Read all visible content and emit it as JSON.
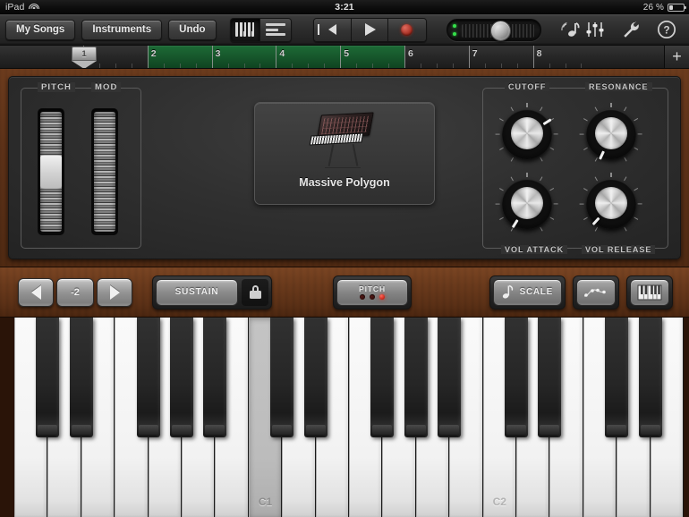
{
  "status_bar": {
    "device": "iPad",
    "wifi_icon": "wifi-icon",
    "time": "3:21",
    "battery_percent": "26 %",
    "battery_icon": "battery-icon"
  },
  "toolbar": {
    "my_songs": "My Songs",
    "instruments": "Instruments",
    "undo": "Undo",
    "view_keyboard_icon": "keyboard-icon",
    "view_tracks_icon": "tracks-list-icon",
    "rewind_icon": "rewind-icon",
    "play_icon": "play-icon",
    "record_icon": "record-icon",
    "master_volume_icon": "master-volume-slider",
    "metronome_icon": "metronome-note-icon",
    "mixer_icon": "mixer-faders-icon",
    "settings_icon": "wrench-icon",
    "help_icon": "help-question-icon"
  },
  "ruler": {
    "playhead_label": "1",
    "bars": [
      "1",
      "2",
      "3",
      "4",
      "5",
      "6",
      "7",
      "8"
    ],
    "loop_start_bar": "2",
    "loop_end_bar": "6",
    "add_section_label": "+",
    "loop_color": "#17582c"
  },
  "synth": {
    "pitch_label": "PITCH",
    "mod_label": "MOD",
    "instrument_name": "Massive Polygon",
    "instrument_art_icon": "synth-rack-icon",
    "knobs": [
      {
        "label": "CUTOFF",
        "angle": 58
      },
      {
        "label": "RESONANCE",
        "angle": 205
      },
      {
        "label": "VOL ATTACK",
        "angle": 212
      },
      {
        "label": "VOL RELEASE",
        "angle": 222
      }
    ]
  },
  "control_strip": {
    "octave_down_icon": "arrow-left-icon",
    "octave_value": "-2",
    "octave_up_icon": "arrow-right-icon",
    "sustain_label": "SUSTAIN",
    "lock_icon": "lock-icon",
    "pitch_label": "PITCH",
    "pitch_leds": [
      "off",
      "off",
      "on"
    ],
    "scale_label": "SCALE",
    "scale_note_icon": "eighth-note-icon",
    "arpeggiator_icon": "arpeggiator-icon",
    "keyboard_size_icon": "keyboard-size-icon"
  },
  "piano": {
    "labeled_keys": [
      {
        "index": 7,
        "label": "C1",
        "pressed": true
      },
      {
        "index": 14,
        "label": "C2",
        "pressed": false
      }
    ],
    "white_key_count": 20,
    "black_key_pattern": [
      0,
      1,
      3,
      4,
      5
    ]
  }
}
